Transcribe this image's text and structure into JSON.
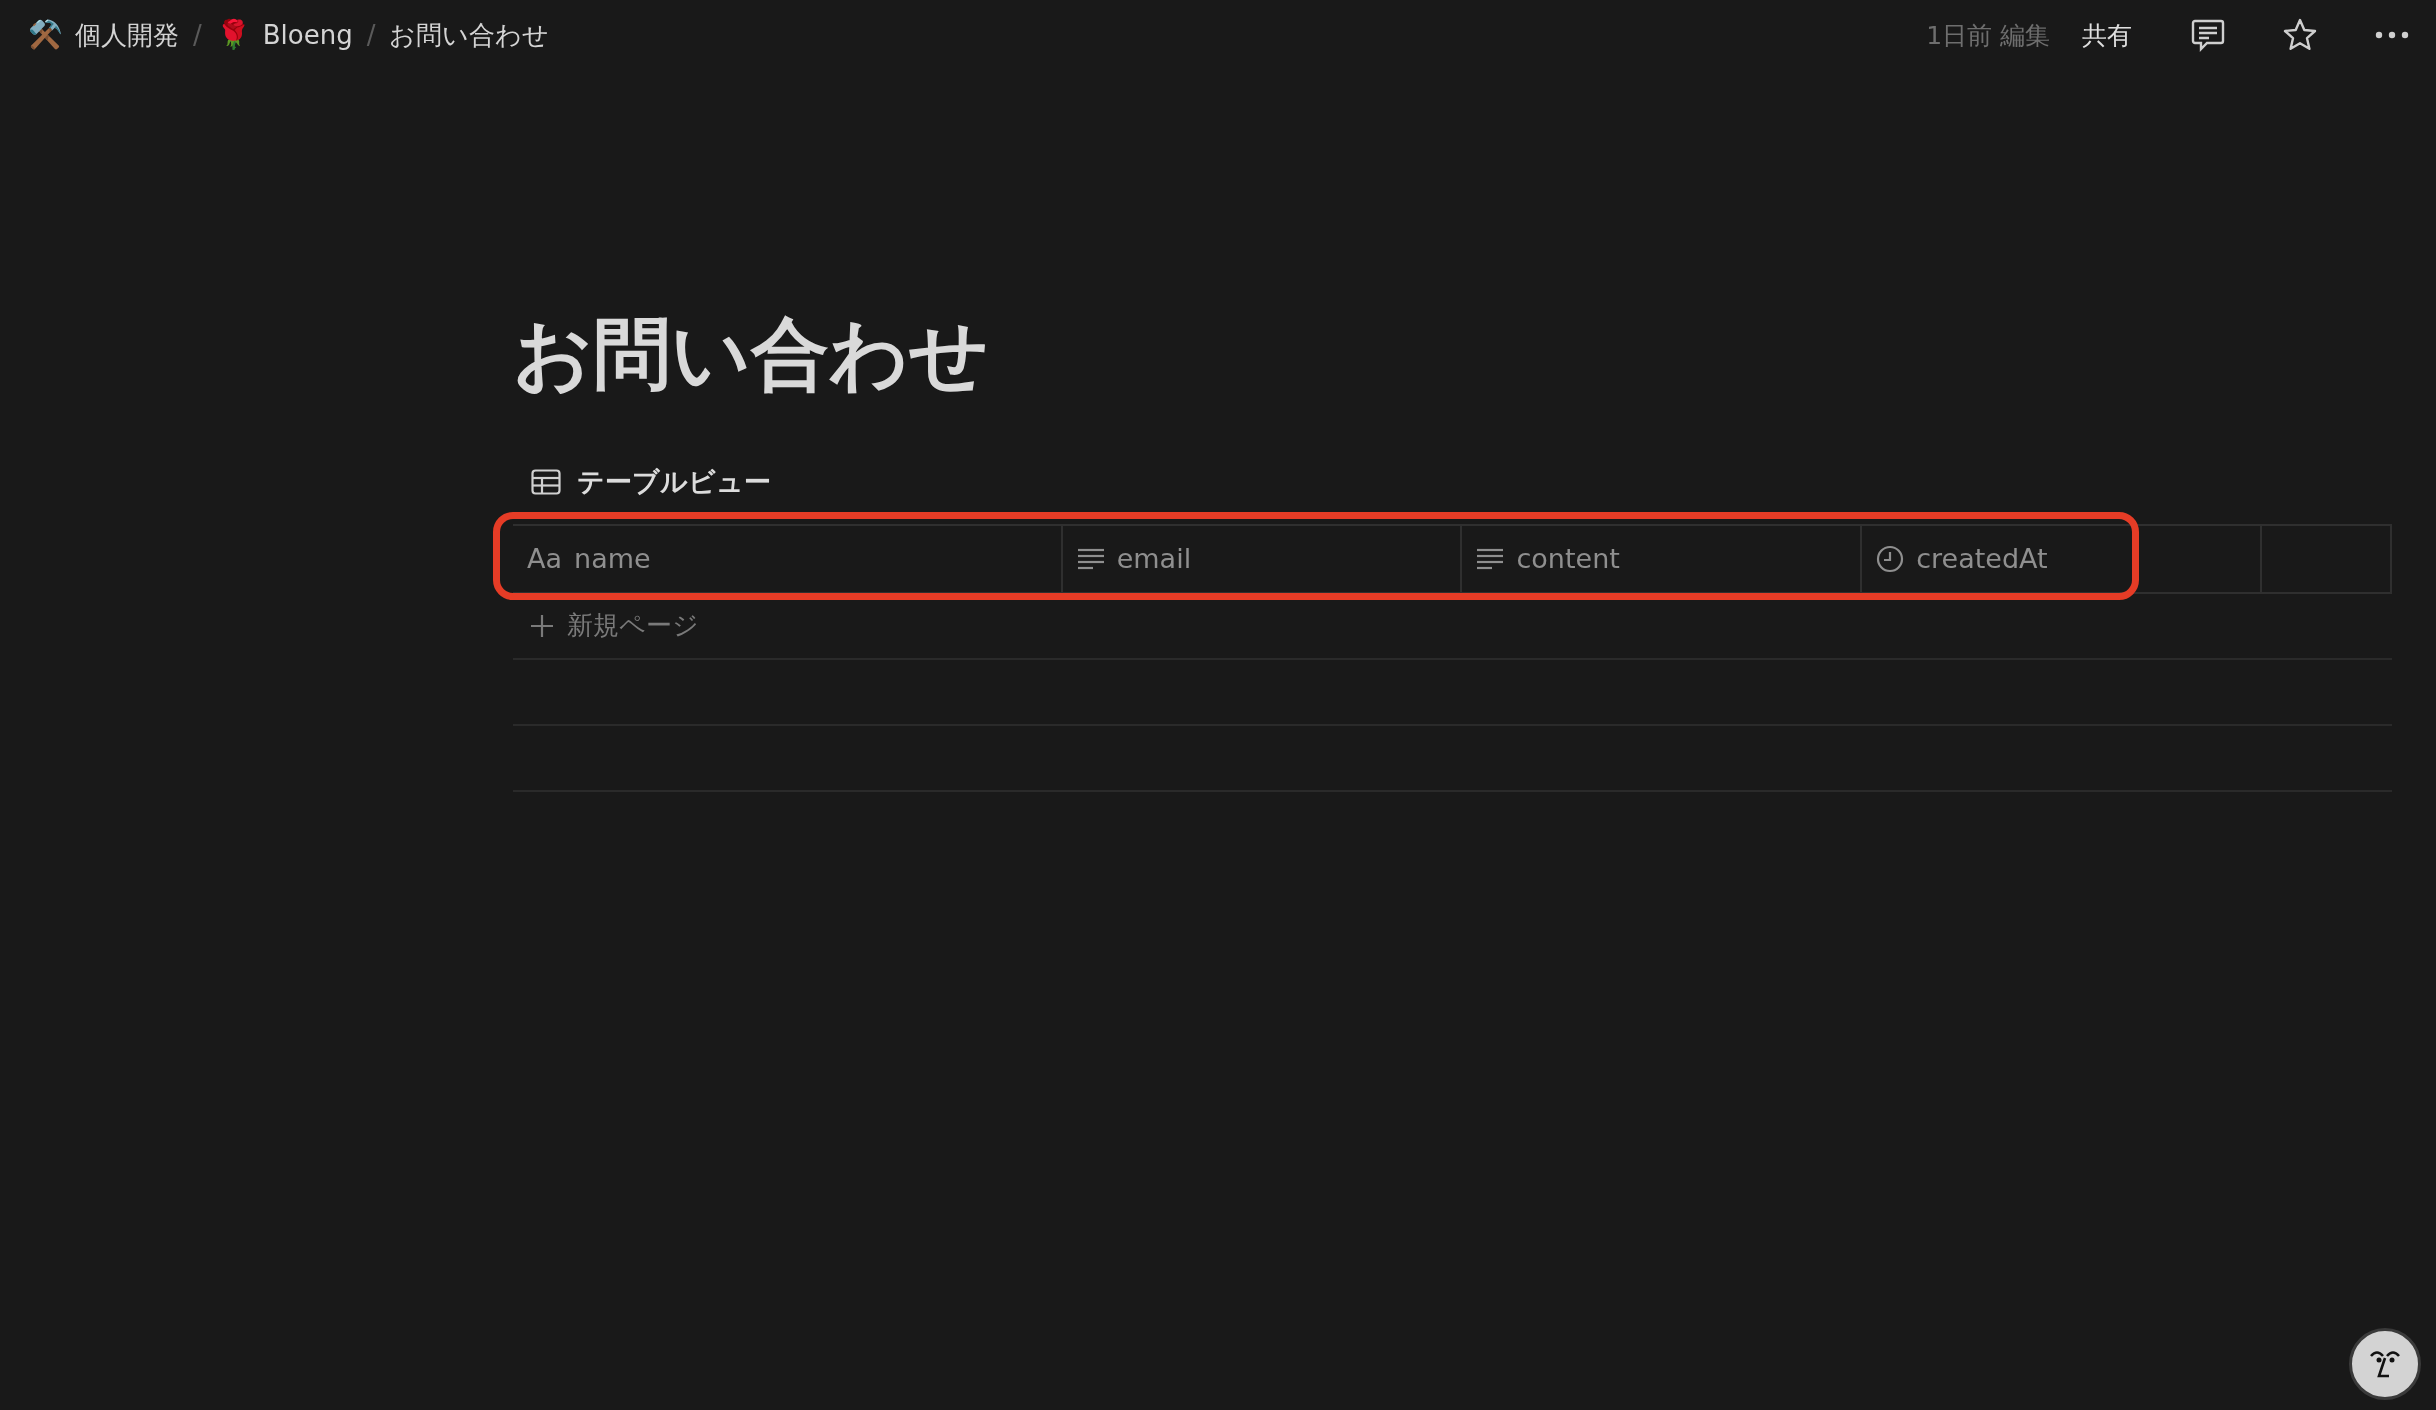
{
  "breadcrumbs": [
    {
      "icon": "⚒️",
      "label": "個人開発"
    },
    {
      "separator": "/",
      "icon": "🌹",
      "label": "Bloeng"
    },
    {
      "separator": "/",
      "label": "お問い合わせ"
    }
  ],
  "topbar": {
    "edited": "1日前 編集",
    "share": "共有"
  },
  "title": "お問い合わせ",
  "view_tab": {
    "label": "テーブルビュー"
  },
  "table": {
    "columns": [
      {
        "kind": "title",
        "icon_text": "Aa",
        "label": "name"
      },
      {
        "kind": "text",
        "label": "email"
      },
      {
        "kind": "text",
        "label": "content"
      },
      {
        "kind": "date",
        "label": "createdAt"
      }
    ],
    "new_row": "新規ページ"
  }
}
